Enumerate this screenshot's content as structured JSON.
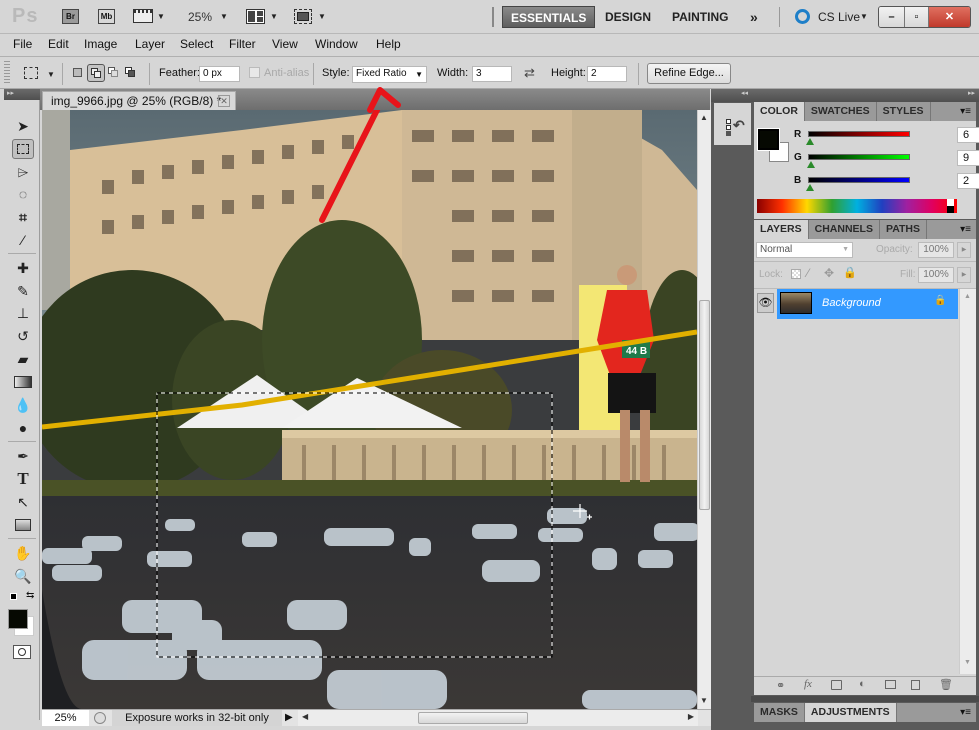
{
  "app": {
    "logo": "Ps",
    "bridge_label": "Br",
    "minibridge_label": "Mb",
    "zoom_level": "25%",
    "workspaces": [
      "ESSENTIALS",
      "DESIGN",
      "PAINTING"
    ],
    "active_workspace": "ESSENTIALS",
    "more_workspaces": "»",
    "cs_live": "CS Live",
    "window_buttons": {
      "minimize": "–",
      "restore": "▫",
      "close": "✕"
    }
  },
  "menu": [
    "File",
    "Edit",
    "Image",
    "Layer",
    "Select",
    "Filter",
    "View",
    "Window",
    "Help"
  ],
  "options": {
    "feather_label": "Feather:",
    "feather_value": "0 px",
    "antialias_label": "Anti-alias",
    "style_label": "Style:",
    "style_value": "Fixed Ratio",
    "width_label": "Width:",
    "width_value": "3",
    "height_label": "Height:",
    "height_value": "2",
    "refine_edge": "Refine Edge..."
  },
  "document": {
    "tab_title": "img_9966.jpg @ 25% (RGB/8) *",
    "zoom": "25%",
    "status": "Exposure works in 32-bit only",
    "race_bib": "44 B"
  },
  "tools": [
    "move",
    "rectangular-marquee",
    "polygonal-lasso",
    "quick-selection",
    "crop",
    "eyedropper",
    "spot-healing",
    "brush",
    "clone-stamp",
    "history-brush",
    "eraser",
    "gradient",
    "blur",
    "dodge",
    "pen",
    "type",
    "path-selection",
    "rectangle",
    "hand",
    "zoom"
  ],
  "color_panel": {
    "tabs": [
      "COLOR",
      "SWATCHES",
      "STYLES"
    ],
    "active_tab": "COLOR",
    "r_label": "R",
    "g_label": "G",
    "b_label": "B",
    "r": "6",
    "g": "9",
    "b": "2",
    "foreground": "#060902",
    "background": "#ffffff"
  },
  "layers_panel": {
    "tabs": [
      "LAYERS",
      "CHANNELS",
      "PATHS"
    ],
    "active_tab": "LAYERS",
    "blend_mode": "Normal",
    "opacity_label": "Opacity:",
    "opacity": "100%",
    "lock_label": "Lock:",
    "fill_label": "Fill:",
    "fill": "100%",
    "layers": [
      {
        "name": "Background",
        "visible": true,
        "locked": true,
        "selected": true
      }
    ]
  },
  "bottom_panel": {
    "tabs": [
      "MASKS",
      "ADJUSTMENTS"
    ],
    "active_tab": "ADJUSTMENTS"
  },
  "colors": {
    "selection_blue": "#3399ff",
    "annotation_red": "#e8141a"
  }
}
